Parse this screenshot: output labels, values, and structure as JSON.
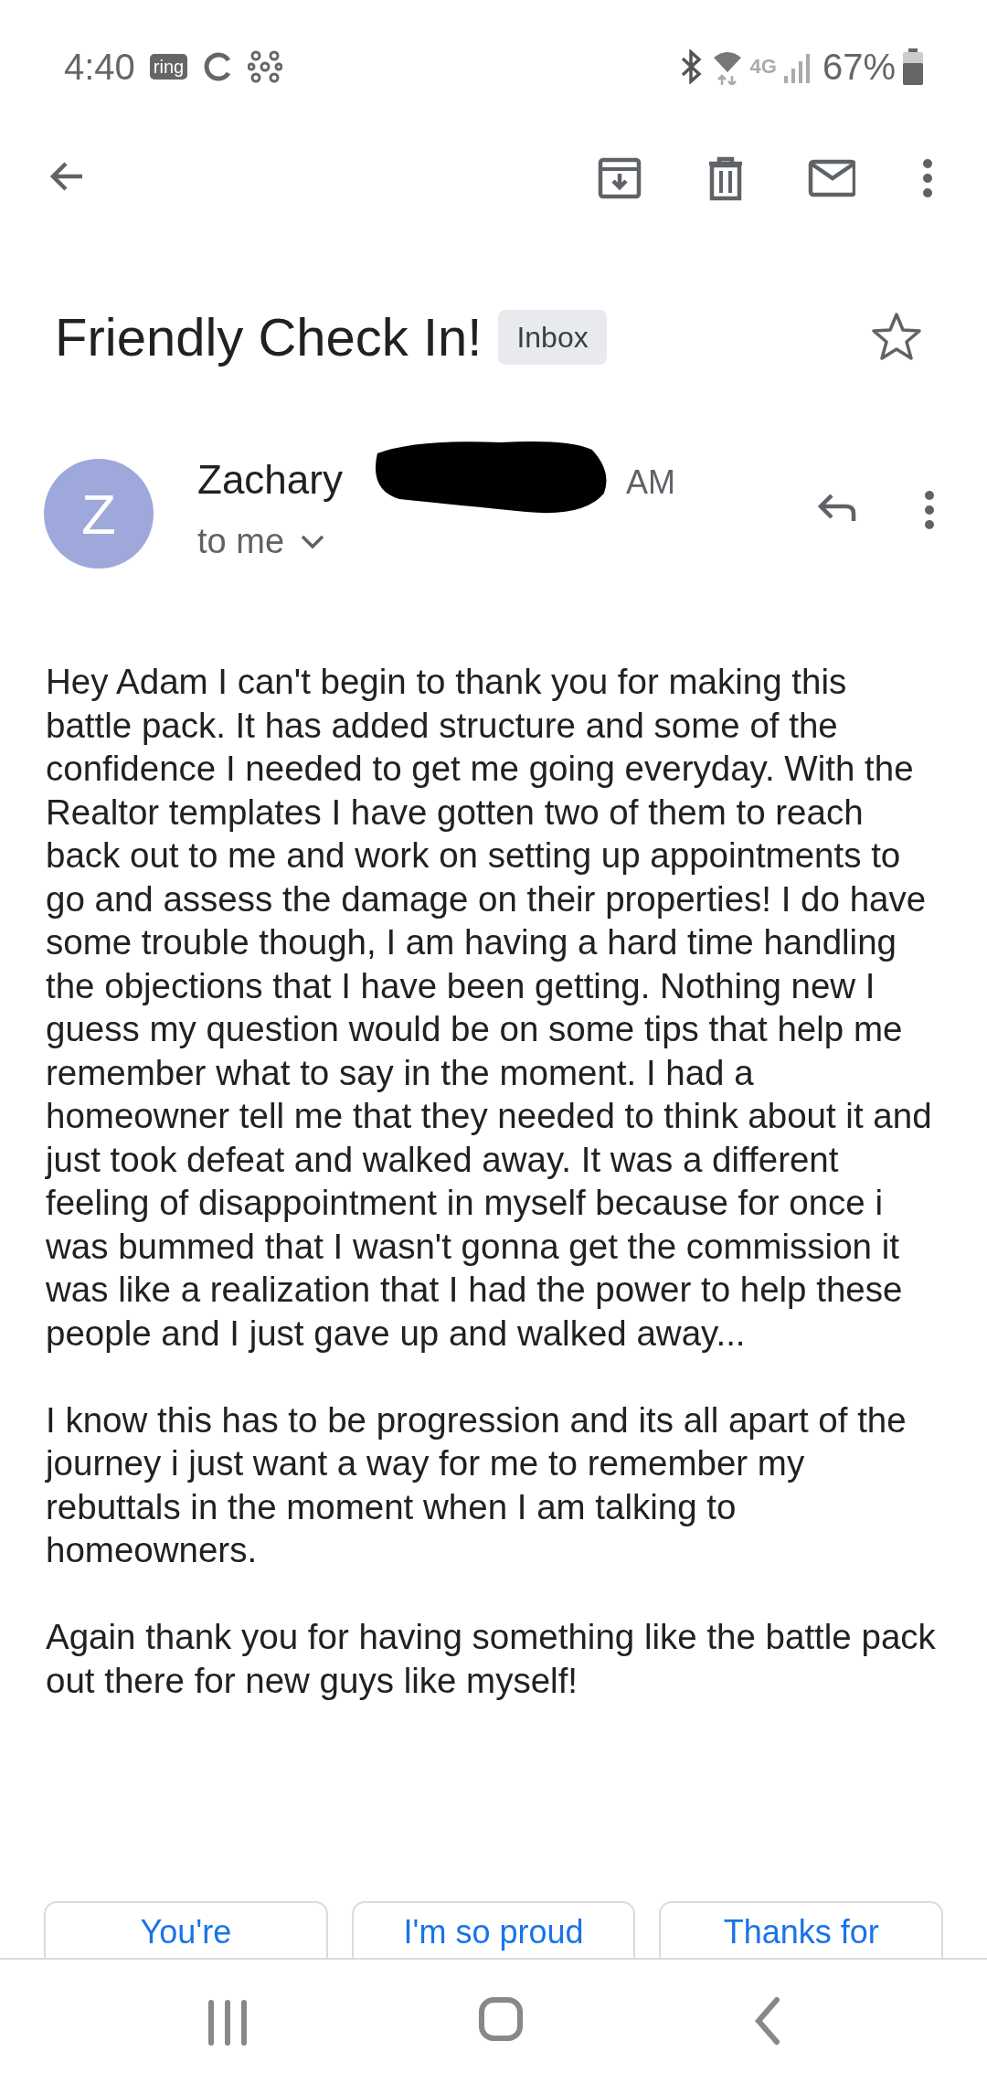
{
  "status_bar": {
    "time": "4:40",
    "ring_label": "ring",
    "network_label": "4G",
    "battery": "67%"
  },
  "toolbar": {
    "actions": [
      {
        "kind": "back"
      },
      {
        "kind": "archive"
      },
      {
        "kind": "delete"
      },
      {
        "kind": "unread"
      },
      {
        "kind": "more"
      }
    ]
  },
  "subject": {
    "title": "Friendly Check In!",
    "label": "Inbox",
    "starred": false
  },
  "message": {
    "avatar_letter": "Z",
    "sender": "Zachary",
    "time": "AM",
    "recipient": "to me",
    "redacted": true,
    "paragraphs": [
      "Hey Adam I can't begin to thank you for making this battle pack. It has added structure and some of the confidence I needed to get me going everyday. With the Realtor templates I have gotten two of them to reach back out to me and work on setting up appointments to go and assess the damage on their properties! I do have some trouble though, I am having a hard time handling the objections that I have been getting. Nothing new I guess my question would be on some tips that help me remember what to say in the moment. I had a homeowner tell me that they needed to think about it and just took defeat and walked away. It was a different feeling of disappointment in myself because for once i was bummed that I wasn't gonna get the commission it was like a realization that I had the power to help these people and I just gave up and walked away...",
      "I know this has to be progression and its all apart of the journey i just want a way for me to remember my rebuttals in the moment when I am talking to homeowners.",
      "Again thank you for having something like the battle pack out there for new guys like myself!"
    ]
  },
  "smart_replies": [
    "You're",
    "I'm so proud",
    "Thanks for"
  ],
  "nav_bar": [
    {
      "kind": "recents"
    },
    {
      "kind": "home"
    },
    {
      "kind": "back"
    }
  ]
}
